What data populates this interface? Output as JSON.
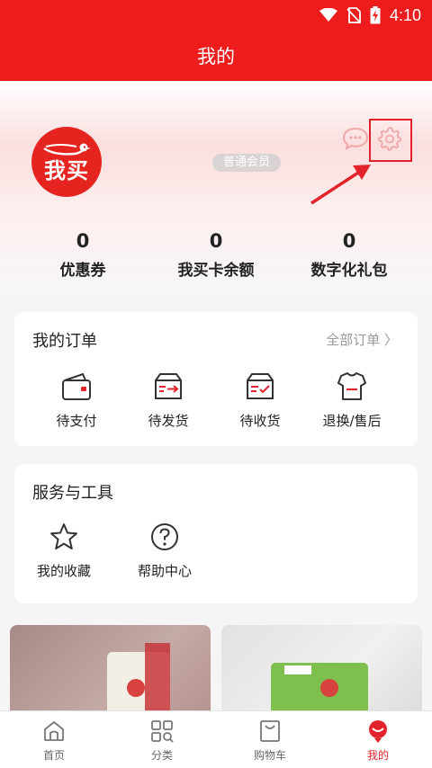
{
  "status_bar": {
    "time": "4:10"
  },
  "title_bar": {
    "title": "我的"
  },
  "profile": {
    "logo_text": "我买",
    "member_level": "普通会员"
  },
  "stats": [
    {
      "value": "0",
      "label": "优惠券"
    },
    {
      "value": "0",
      "label": "我买卡余额"
    },
    {
      "value": "0",
      "label": "数字化礼包"
    }
  ],
  "orders": {
    "title": "我的订单",
    "view_all": "全部订单 〉",
    "items": [
      {
        "label": "待支付",
        "icon": "wallet-icon"
      },
      {
        "label": "待发货",
        "icon": "box-ship-icon"
      },
      {
        "label": "待收货",
        "icon": "box-receive-icon"
      },
      {
        "label": "退换/售后",
        "icon": "after-sale-icon"
      }
    ]
  },
  "services": {
    "title": "服务与工具",
    "items": [
      {
        "label": "我的收藏",
        "icon": "star-icon"
      },
      {
        "label": "帮助中心",
        "icon": "help-icon"
      }
    ]
  },
  "tabs": [
    {
      "label": "首页",
      "icon": "home-icon",
      "active": false
    },
    {
      "label": "分类",
      "icon": "category-icon",
      "active": false
    },
    {
      "label": "购物车",
      "icon": "cart-icon",
      "active": false
    },
    {
      "label": "我的",
      "icon": "profile-icon",
      "active": true
    }
  ],
  "colors": {
    "brand_red": "#ee1c1c",
    "highlight_red": "#e3232b",
    "active_tab": "#e3232b"
  }
}
